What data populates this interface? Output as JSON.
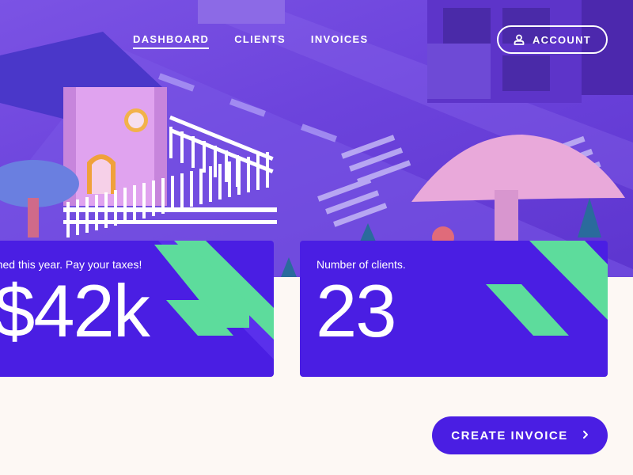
{
  "nav": {
    "items": [
      {
        "label": "DASHBOARD",
        "active": true
      },
      {
        "label": "CLIENTS",
        "active": false
      },
      {
        "label": "INVOICES",
        "active": false
      }
    ],
    "account_label": "ACCOUNT",
    "account_icon": "user-icon"
  },
  "cards": [
    {
      "caption": "Total earned this year. Pay your taxes!",
      "value": "$42k"
    },
    {
      "caption": "Number of clients.",
      "value": "23"
    }
  ],
  "actions": {
    "create_invoice_label": "CREATE INVOICE",
    "create_invoice_icon": "chevron-right-icon"
  },
  "colors": {
    "brand": "#4a1ee3",
    "accent": "#5ddc9c",
    "background": "#fdf8f4",
    "hero": "#6c43dc"
  }
}
